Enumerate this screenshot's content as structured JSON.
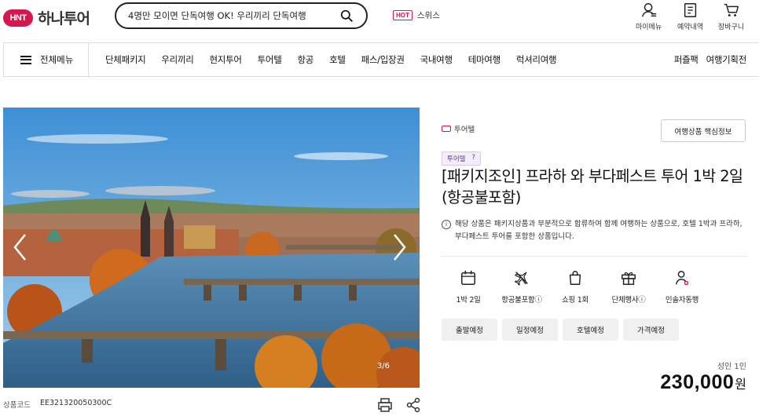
{
  "header": {
    "logo_badge": "HNT",
    "logo_text": "하나투어",
    "search": {
      "value": "4명만 모이면 단독여행 OK! 우리끼리 단독여행"
    },
    "hot": {
      "badge": "HOT",
      "text": "스위스"
    },
    "utilities": [
      {
        "label": "마이메뉴",
        "icon": "user-icon"
      },
      {
        "label": "예약내역",
        "icon": "document-icon"
      },
      {
        "label": "장바구니",
        "icon": "cart-icon"
      }
    ]
  },
  "nav": {
    "all_menu": "전체메뉴",
    "items": [
      "단체패키지",
      "우리끼리",
      "현지투어",
      "투어텔",
      "항공",
      "호텔",
      "패스/입장권",
      "국내여행",
      "테마여행",
      "럭셔리여행"
    ],
    "right": [
      "퍼즐팩",
      "여행기획전"
    ]
  },
  "gallery": {
    "counter": "3/6"
  },
  "product": {
    "code_label": "상품코드",
    "code": "EE321320050300C",
    "category": "투어텔",
    "key_info_button": "여행상품 핵심정보",
    "tag_label": "투어텔",
    "tag_help": "?",
    "title": "[패키지조인] 프라하 와 부다페스트 투어 1박 2일 (항공불포함)",
    "notice": "해당 상품은 패키지상품과 부분적으로 합류하여 함께 여행하는 상품으로, 호텔 1박과 프라하, 부다페스트 투어를 포함한 상품입니다.",
    "features": [
      {
        "label": "1박 2일",
        "icon": "calendar-icon"
      },
      {
        "label": "항공불포함ⓘ",
        "icon": "no-flight-icon"
      },
      {
        "label": "쇼핑 1회",
        "icon": "shopping-bag-icon"
      },
      {
        "label": "단체행사ⓘ",
        "icon": "gift-icon"
      },
      {
        "label": "인솔자동행",
        "icon": "guide-person-icon"
      }
    ],
    "schedule_buttons": [
      "출발예정",
      "일정예정",
      "호텔예정",
      "가격예정"
    ],
    "price_label": "성인 1인",
    "price": "230,000",
    "price_unit": "원"
  },
  "colors": {
    "brand": "#d6164e",
    "tag_bg": "#f3edf9",
    "tag_text": "#5b3b8f"
  }
}
